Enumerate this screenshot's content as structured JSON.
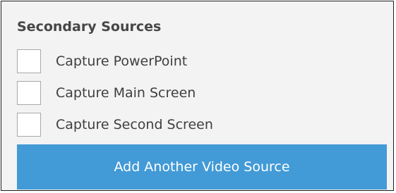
{
  "section": {
    "title": "Secondary Sources"
  },
  "options": [
    {
      "label": "Capture PowerPoint",
      "checked": false
    },
    {
      "label": "Capture Main Screen",
      "checked": false
    },
    {
      "label": "Capture Second Screen",
      "checked": false
    }
  ],
  "actions": {
    "add_source_label": "Add Another Video Source"
  },
  "colors": {
    "panel_background": "#f3f3f3",
    "button_background": "#429ad6",
    "button_text": "#ffffff"
  }
}
